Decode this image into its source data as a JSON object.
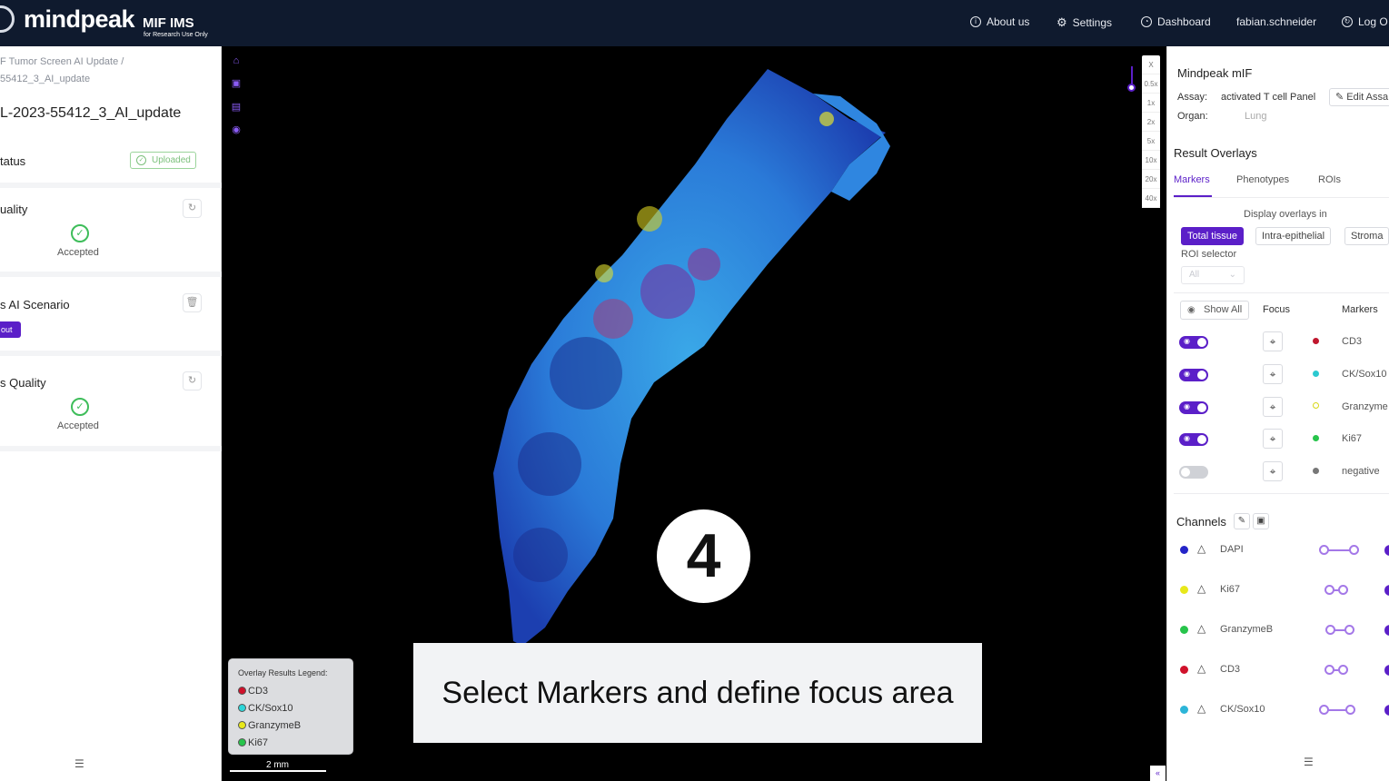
{
  "app": {
    "brand": "mindpeak",
    "product": "MIF IMS",
    "ruo": "for Research Use Only"
  },
  "nav": {
    "about": "About us",
    "settings": "Settings",
    "dashboard": "Dashboard",
    "user": "fabian.schneider",
    "logout": "Log O"
  },
  "left": {
    "crumb1": "F Tumor Screen AI Update  /",
    "crumb2": "55412_3_AI_update",
    "title": "L-2023-55412_3_AI_update",
    "status_label": "tatus",
    "status_badge": "Uploaded",
    "quality_label": "uality",
    "quality_state": "Accepted",
    "scenario_label": "s AI Scenario",
    "scenario_badge": "out",
    "s_quality_label": "s Quality",
    "s_quality_state": "Accepted"
  },
  "viewer": {
    "zoom_levels": [
      "X",
      "0.5x",
      "1x",
      "2x",
      "5x",
      "10x",
      "20x",
      "40x"
    ],
    "step_number": "4",
    "caption": "Select Markers and define focus area",
    "legend": {
      "title": "Overlay Results Legend:",
      "items": [
        {
          "label": "CD3",
          "color": "#d0112b"
        },
        {
          "label": "CK/Sox10",
          "color": "#2cd5d8"
        },
        {
          "label": "GranzymeB",
          "color": "#e8e81a"
        },
        {
          "label": "Ki67",
          "color": "#27c44b"
        }
      ]
    },
    "scale": "2 mm"
  },
  "right": {
    "heading": "Mindpeak mIF",
    "assay_label": "Assay:",
    "assay_value": "activated T cell Panel",
    "edit_assay": "Edit Assa",
    "organ_label": "Organ:",
    "organ_value": "Lung",
    "overlays_title": "Result Overlays",
    "tabs": [
      "Markers",
      "Phenotypes",
      "ROIs"
    ],
    "display_in": "Display overlays in",
    "areas": [
      "Total tissue",
      "Intra-epithelial",
      "Stroma"
    ],
    "roi_selector": "ROI selector",
    "roi_value": "All",
    "show_all": "Show All",
    "col_focus": "Focus",
    "col_markers": "Markers",
    "markers": [
      {
        "name": "CD3",
        "color": "#c0172e",
        "on": true
      },
      {
        "name": "CK/Sox10",
        "color": "#2cc9d0",
        "on": true
      },
      {
        "name": "Granzyme",
        "color": "#d8d815",
        "on": true
      },
      {
        "name": "Ki67",
        "color": "#27c44b",
        "on": true
      },
      {
        "name": "negative",
        "color": "#777777",
        "on": false
      }
    ],
    "channels_title": "Channels",
    "channels": [
      {
        "name": "DAPI",
        "color": "#2424c8"
      },
      {
        "name": "Ki67",
        "color": "#e8e81a"
      },
      {
        "name": "GranzymeB",
        "color": "#27c44b"
      },
      {
        "name": "CD3",
        "color": "#d0112b"
      },
      {
        "name": "CK/Sox10",
        "color": "#2cb5d8"
      }
    ]
  }
}
